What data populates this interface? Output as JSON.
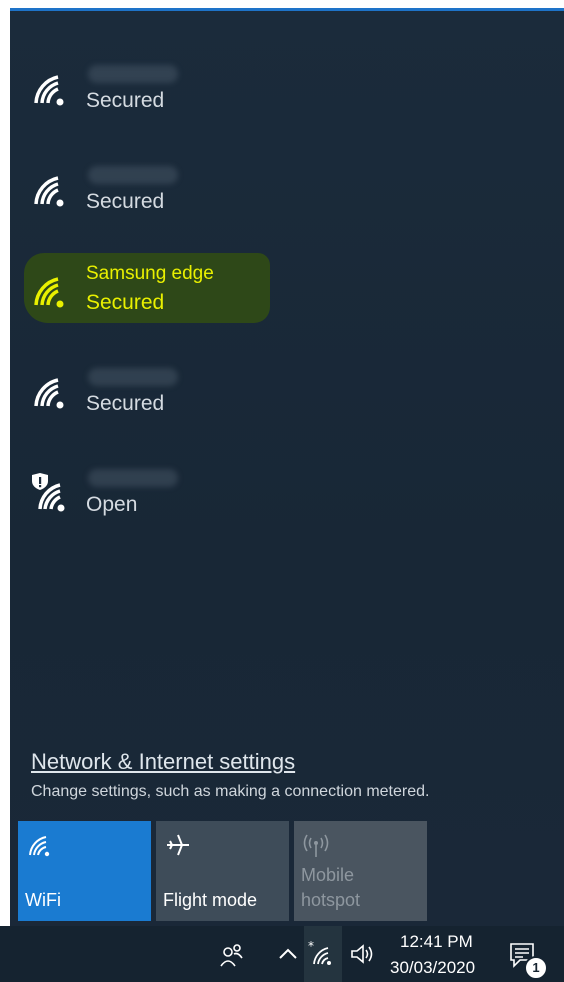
{
  "networks": [
    {
      "name": "",
      "status": "Secured",
      "icon": "wifi-icon"
    },
    {
      "name": "",
      "status": "Secured",
      "icon": "wifi-icon"
    },
    {
      "name": "Samsung edge",
      "status": "Secured",
      "icon": "wifi-icon",
      "highlighted": true
    },
    {
      "name": "",
      "status": "Secured",
      "icon": "wifi-icon"
    },
    {
      "name": "",
      "status": "Open",
      "icon": "wifi-shield-warning-icon"
    }
  ],
  "settings": {
    "link": "Network & Internet settings",
    "description": "Change settings, such as making a connection metered."
  },
  "quick_actions": [
    {
      "label": "WiFi",
      "icon": "wifi-icon",
      "state": "on"
    },
    {
      "label": "Flight mode",
      "icon": "airplane-icon",
      "state": "off"
    },
    {
      "label": "Mobile hotspot",
      "icon": "hotspot-icon",
      "state": "disabled"
    }
  ],
  "taskbar": {
    "time": "12:41 PM",
    "date": "30/03/2020",
    "notification_count": "1"
  },
  "colors": {
    "flyout_bg": "#1b2b3b",
    "accent": "#1a7bd1",
    "highlight_text": "#e9f000",
    "highlight_bg": "#2f4a16"
  }
}
